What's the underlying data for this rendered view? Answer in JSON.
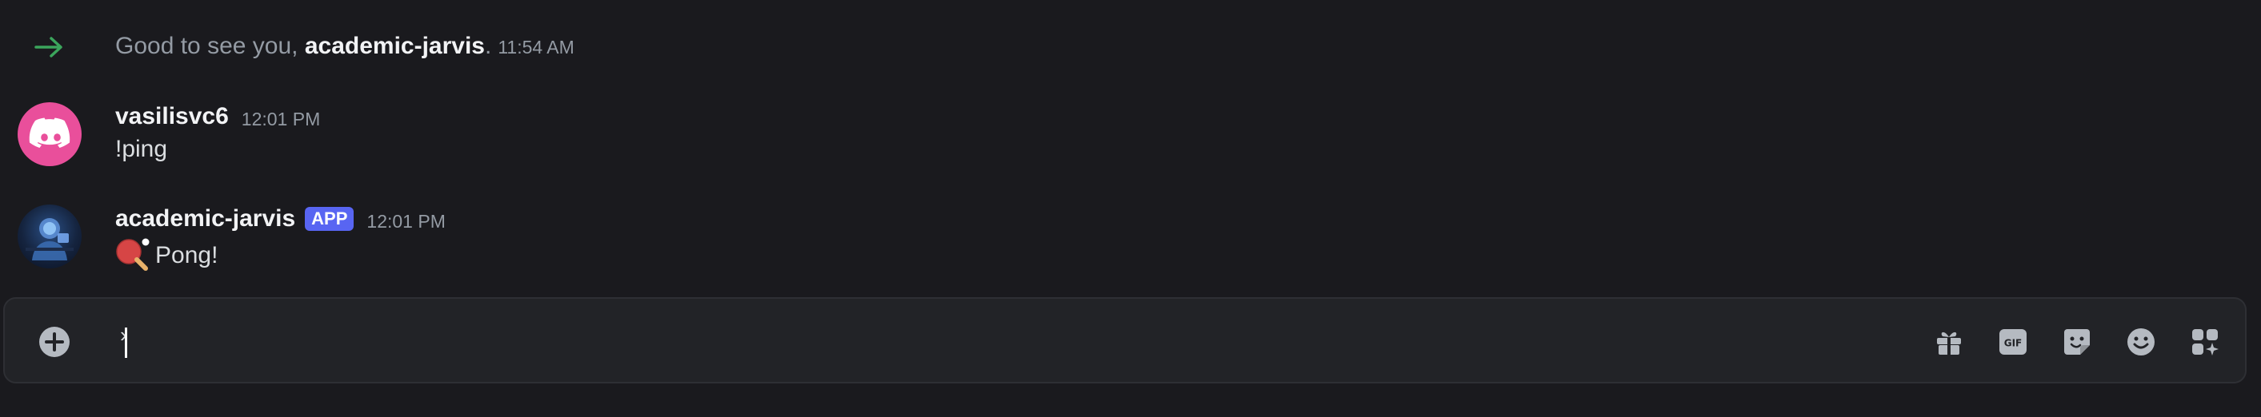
{
  "top_fragment": "'",
  "system_message": {
    "prefix": "Good to see you, ",
    "username": "academic-jarvis",
    "suffix": ".",
    "timestamp": "11:54 AM"
  },
  "messages": [
    {
      "username": "vasilisvc6",
      "timestamp": "12:01 PM",
      "content": "!ping"
    },
    {
      "username": "academic-jarvis",
      "badge": "APP",
      "timestamp": "12:01 PM",
      "emoji": "ping-pong-paddle-icon",
      "content": "Pong!"
    }
  ],
  "composer": {
    "value": "",
    "caret_char": "›"
  },
  "icons": {
    "system_arrow": "arrow-right-icon",
    "plus": "plus-circle-icon",
    "gift": "gift-icon",
    "gif": "gif-icon",
    "gif_label": "GIF",
    "sticker": "sticker-icon",
    "emoji": "smiley-icon",
    "apps": "apps-icon"
  },
  "colors": {
    "background": "#1a1a1e",
    "composer_bg": "#222327",
    "accent_green": "#3ba55c",
    "badge_blurple": "#5865f2",
    "discord_avatar_pink": "#e94f9b",
    "muted_text": "#949ba4",
    "username_text": "#f2f3f5"
  }
}
